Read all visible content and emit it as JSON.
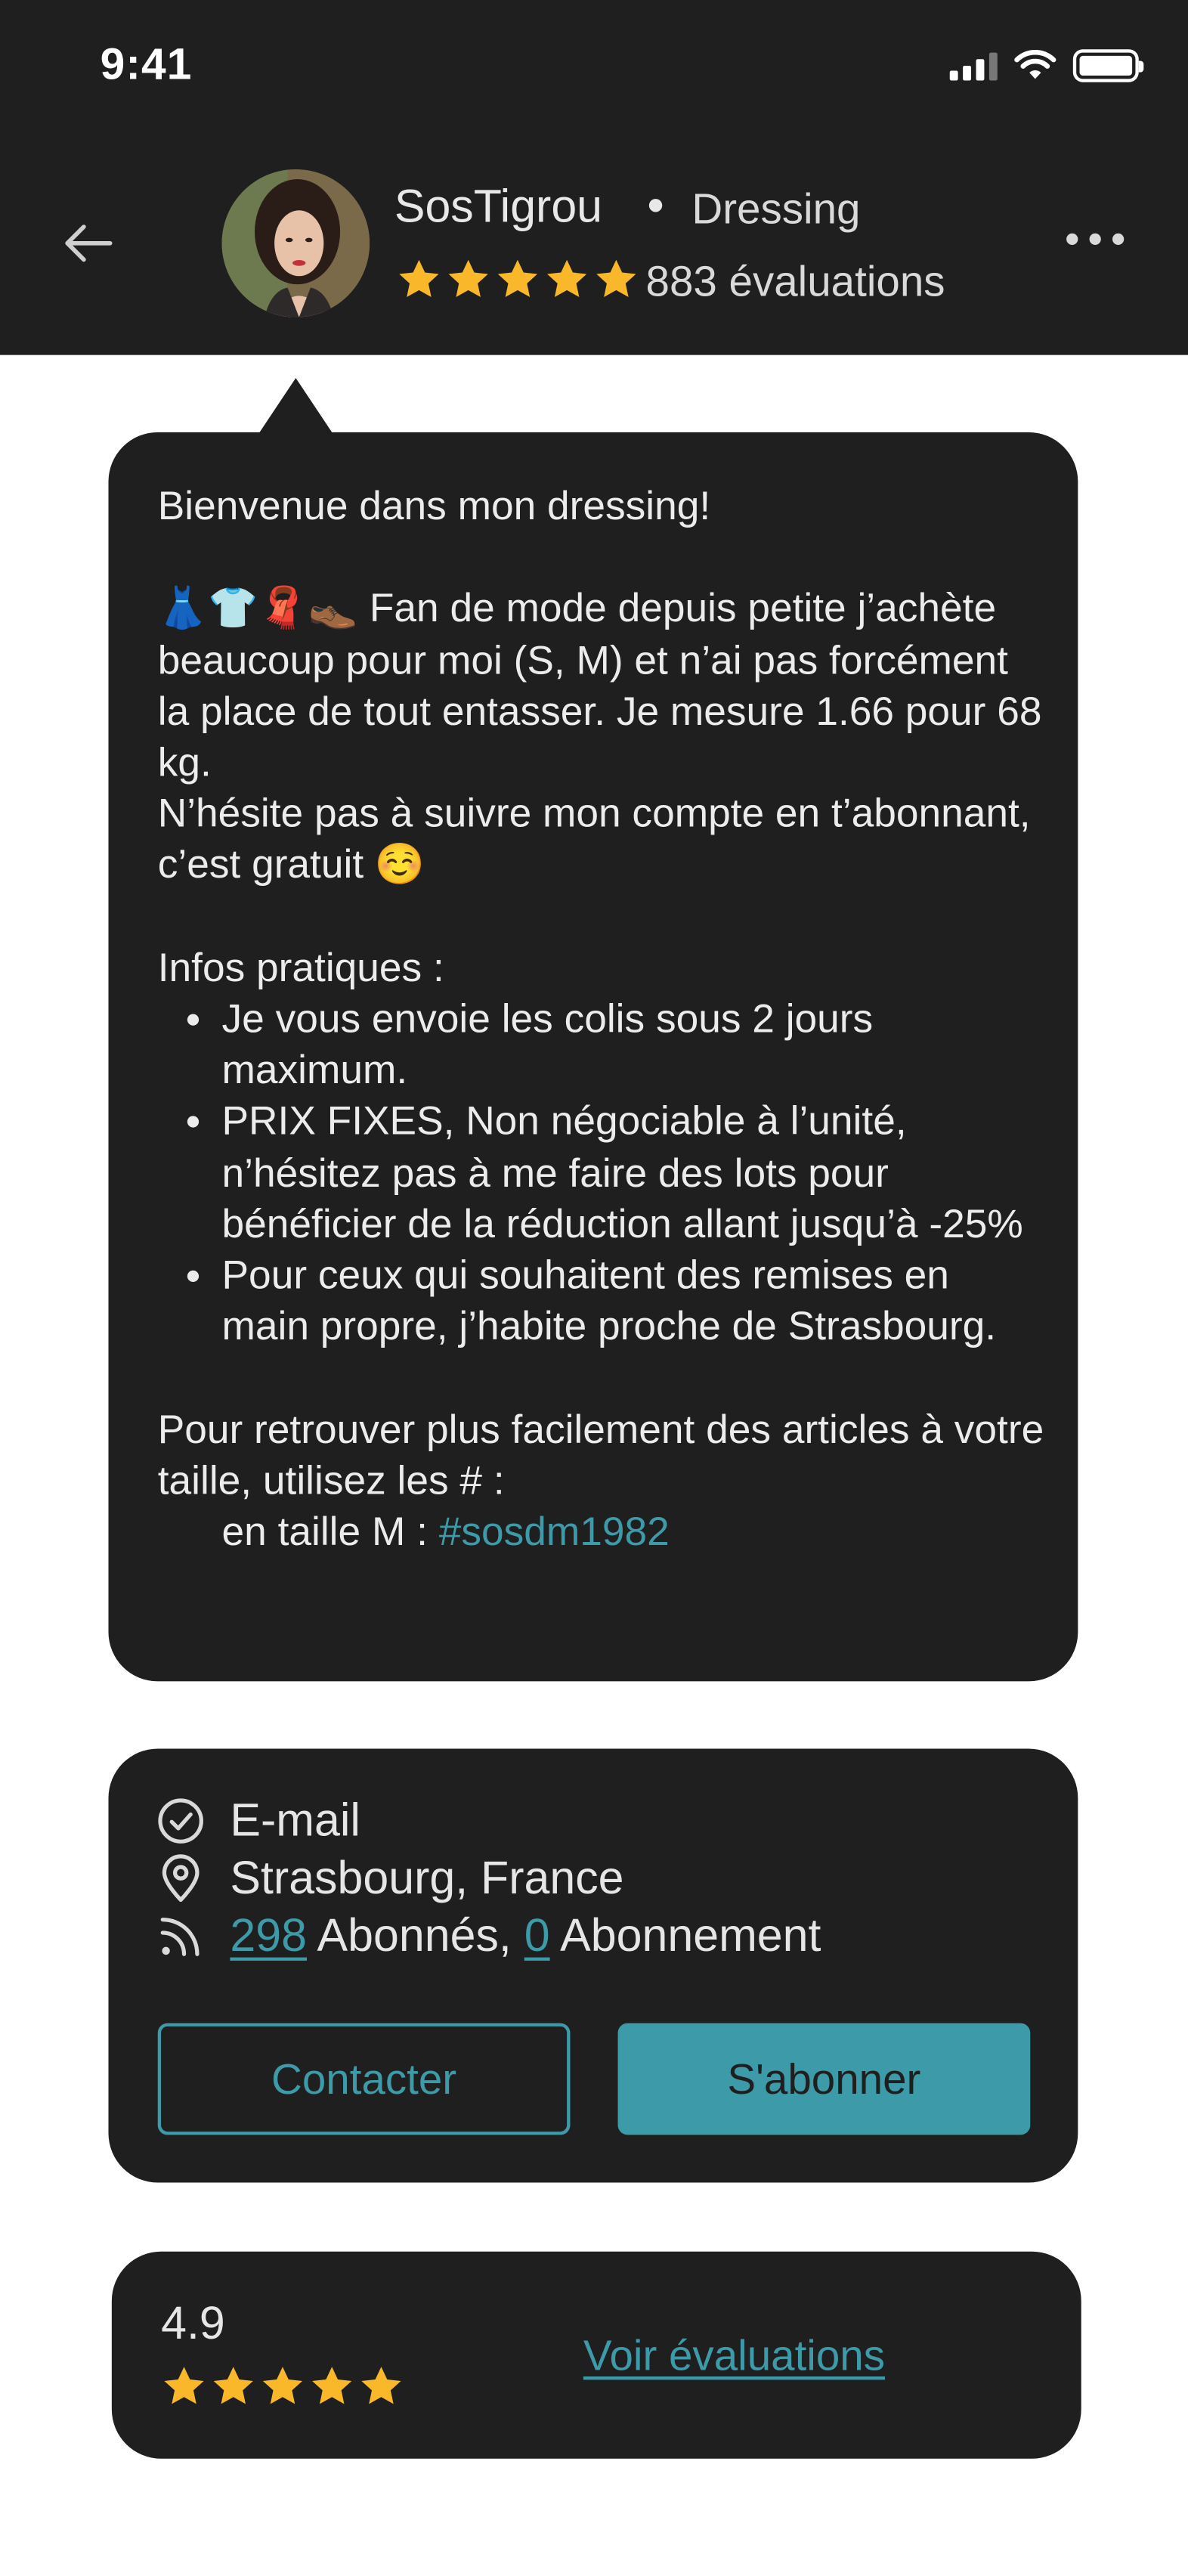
{
  "status_bar": {
    "time": "9:41"
  },
  "header": {
    "username": "SosTigrou",
    "category": "Dressing",
    "rating_stars": 5,
    "review_count_label": "883 évaluations"
  },
  "bio": {
    "greeting": "Bienvenue dans mon dressing!",
    "emojis": "👗👕🧣👞",
    "intro_text": " Fan de mode depuis petite j’achète beaucoup pour moi (S, M) et n’ai pas forcément la place de tout entasser. Je mesure 1.66 pour 68 kg.",
    "follow_text": "N’hésite pas à suivre mon compte en t’abonnant, c’est gratuit ☺️",
    "infos_title": "Infos pratiques :",
    "infos": [
      "Je vous envoie les colis sous 2 jours maximum.",
      "PRIX FIXES, Non négociable à l’unité, n’hésitez pas à me faire des lots pour bénéficier de la réduction allant jusqu’à -25%",
      "Pour ceux qui souhaitent des remises en main propre, j’habite proche de Strasbourg."
    ],
    "hashtag_intro": "Pour retrouver plus facilement des articles à votre taille, utilisez les # :",
    "hashtag_prefix": "en taille M : ",
    "hashtag": "#sosdm1982"
  },
  "info": {
    "email_label": "E-mail",
    "location": "Strasbourg, France",
    "followers_count": "298",
    "followers_label": " Abonnés, ",
    "following_count": "0",
    "following_label": " Abonnement",
    "contact_label": "Contacter",
    "follow_label": "S'abonner"
  },
  "rating": {
    "value": "4.9",
    "stars": 5,
    "see_reviews_label": "Voir évaluations"
  },
  "colors": {
    "accent": "#3d9aa8",
    "card_bg": "#1f1f1f",
    "star": "#f8b82a"
  }
}
